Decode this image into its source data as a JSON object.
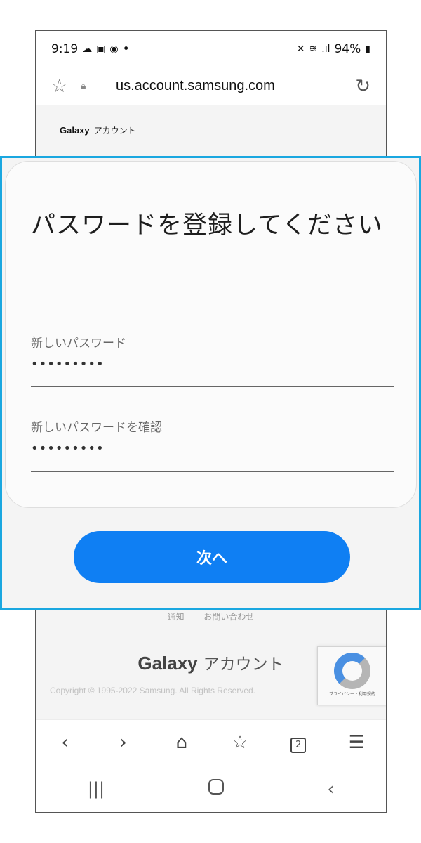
{
  "status_bar": {
    "time": "9:19",
    "dot": "•",
    "signal_text": ".ıl",
    "battery": "94%"
  },
  "url_bar": {
    "domain": "us.account.samsung.com"
  },
  "brand": {
    "name": "Galaxy",
    "sub": "アカウント"
  },
  "form": {
    "title": "パスワードを登録してください",
    "new_password_label": "新しいパスワード",
    "new_password_value": "•••••••••",
    "confirm_password_label": "新しいパスワードを確認",
    "confirm_password_value": "•••••••••",
    "next_label": "次へ"
  },
  "footer": {
    "links": [
      "通知",
      "お問い合わせ"
    ],
    "brand_name": "Galaxy",
    "brand_sub": "アカウント",
    "copyright": "Copyright © 1995-2022 Samsung. All Rights Reserved."
  },
  "recaptcha": {
    "links": "プライバシー・利用規約"
  },
  "browser_nav": {
    "tab_count": "2"
  },
  "colors": {
    "accent": "#0f7ff3",
    "highlight_border": "#1aa7e0"
  }
}
